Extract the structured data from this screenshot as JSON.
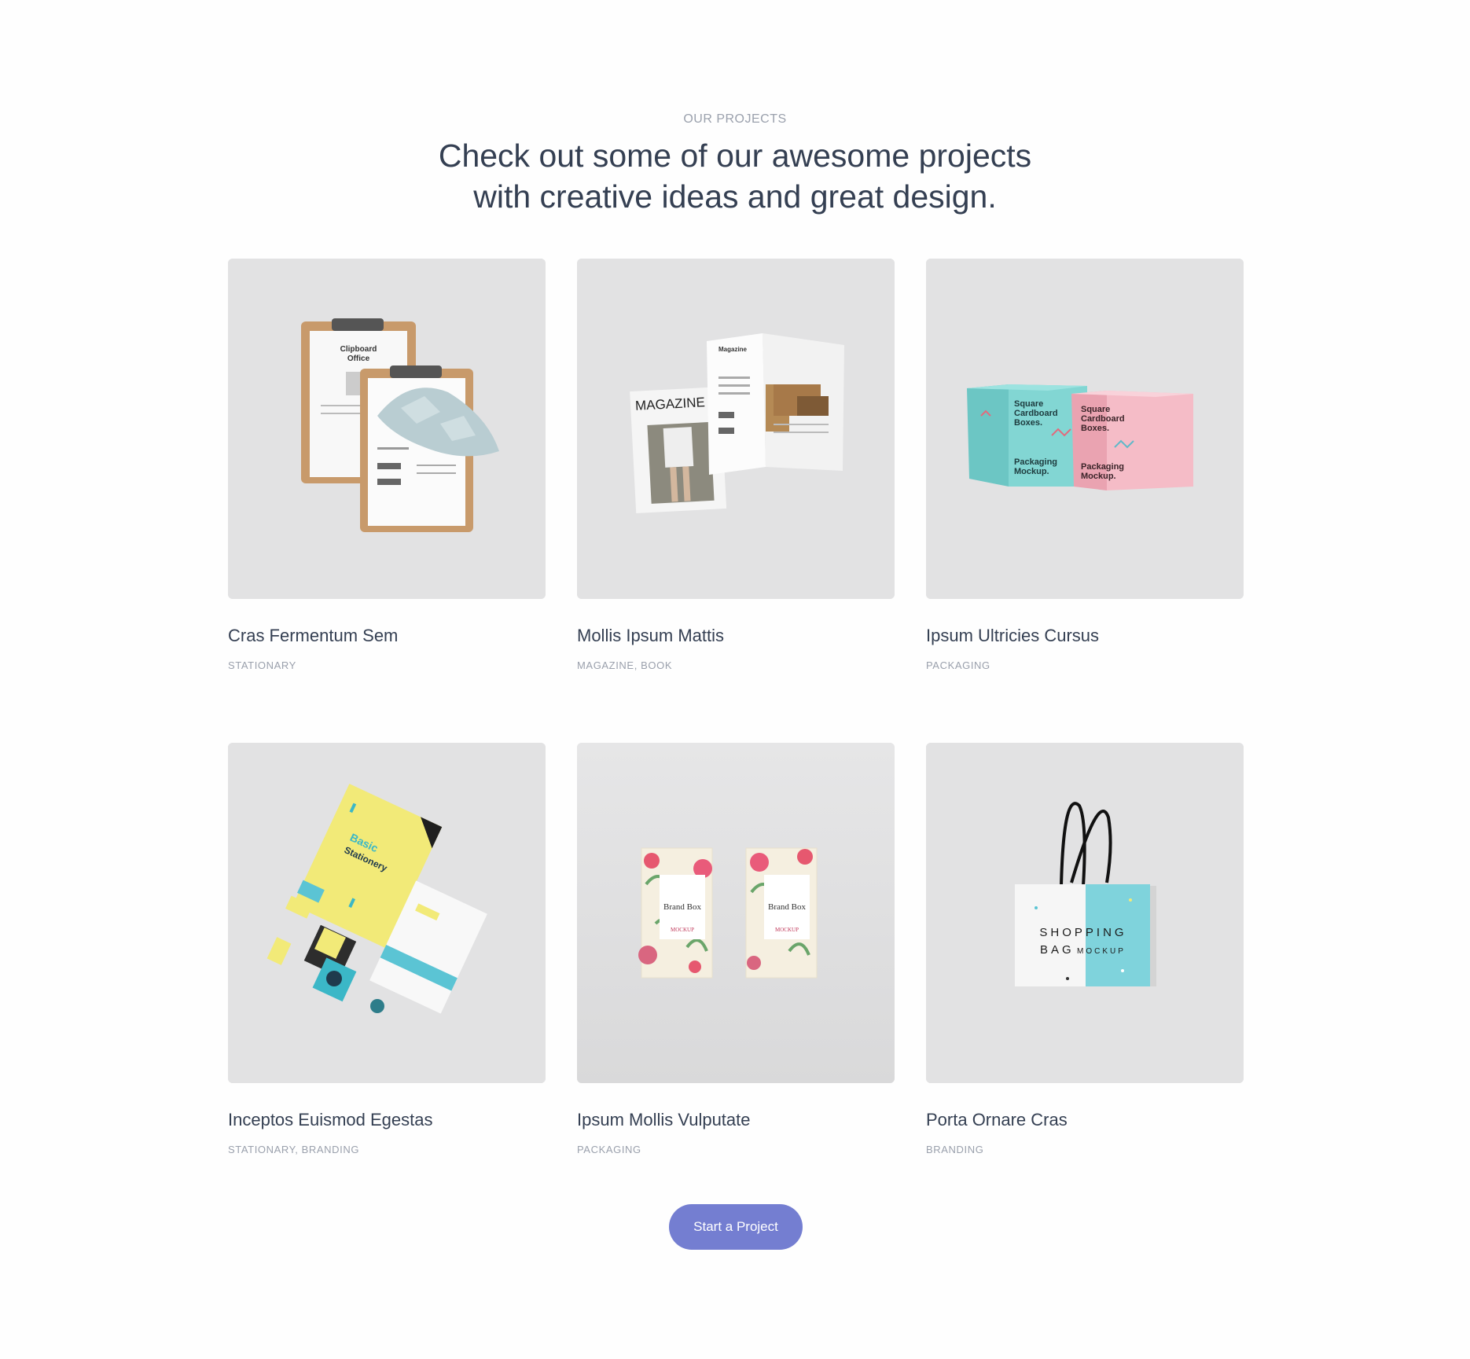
{
  "section": {
    "eyebrow": "OUR PROJECTS",
    "heading_line1": "Check out some of our awesome projects",
    "heading_line2": "with creative ideas and great design."
  },
  "projects": [
    {
      "title": "Cras Fermentum Sem",
      "categories": "STATIONARY",
      "image_icon": "clipboard-mockup-image"
    },
    {
      "title": "Mollis Ipsum Mattis",
      "categories": "MAGAZINE, BOOK",
      "image_icon": "magazine-mockup-image"
    },
    {
      "title": "Ipsum Ultricies Cursus",
      "categories": "PACKAGING",
      "image_icon": "box-mockup-image"
    },
    {
      "title": "Inceptos Euismod Egestas",
      "categories": "STATIONARY, BRANDING",
      "image_icon": "stationery-mockup-image"
    },
    {
      "title": "Ipsum Mollis Vulputate",
      "categories": "PACKAGING",
      "image_icon": "brand-box-mockup-image"
    },
    {
      "title": "Porta Ornare Cras",
      "categories": "BRANDING",
      "image_icon": "shopping-bag-mockup-image"
    }
  ],
  "mockup_text": {
    "clipboard_title1": "Clipboard",
    "clipboard_title2": "Office",
    "magazine_cover": "MAGAZINE",
    "magazine_inner": "Magazine",
    "box1_line1": "Square",
    "box1_line2": "Cardboard",
    "box1_line3": "Boxes.",
    "box1_line4": "Packaging",
    "box1_line5": "Mockup.",
    "stationery_title": "Basic",
    "stationery_sub": "Stationery",
    "brand_box_title": "Brand Box",
    "brand_box_sub": "MOCKUP",
    "bag_line1": "SHOPPING",
    "bag_line2": "BAG",
    "bag_line3": "MOCKUP"
  },
  "cta": {
    "label": "Start a Project"
  },
  "colors": {
    "accent": "#747ed1",
    "heading": "#343f52",
    "muted": "#9aa0ac",
    "thumb_bg": "#e2e2e3",
    "teal": "#7fd3d0",
    "pink": "#f2b5c0",
    "yellow": "#f2ea78",
    "blue": "#5bc4d4"
  }
}
